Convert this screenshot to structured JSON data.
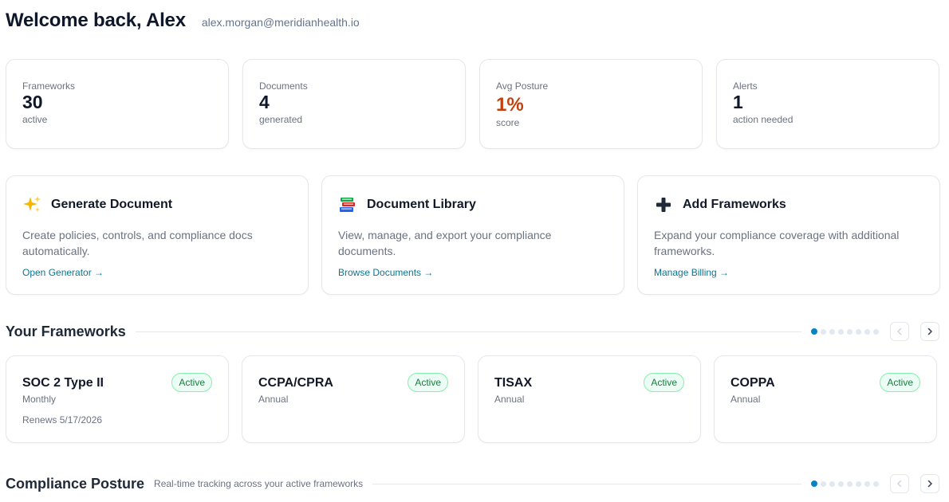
{
  "header": {
    "welcome": "Welcome back, Alex",
    "email": "alex.morgan@meridianhealth.io"
  },
  "stats": [
    {
      "label": "Frameworks",
      "value": "30",
      "sub": "active"
    },
    {
      "label": "Documents",
      "value": "4",
      "sub": "generated"
    },
    {
      "label": "Avg Posture",
      "value": "1%",
      "sub": "score",
      "value_color": "#c2410c"
    },
    {
      "label": "Alerts",
      "value": "1",
      "sub": "action needed"
    }
  ],
  "actions": [
    {
      "icon": "sparkles-icon",
      "title": "Generate Document",
      "desc": "Create policies, controls, and compliance docs automatically.",
      "link": "Open Generator →"
    },
    {
      "icon": "books-icon",
      "title": "Document Library",
      "desc": "View, manage, and export your compliance documents.",
      "link": "Browse Documents →"
    },
    {
      "icon": "plus-icon",
      "title": "Add Frameworks",
      "desc": "Expand your compliance coverage with additional frameworks.",
      "link": "Manage Billing →"
    }
  ],
  "frameworks_section": {
    "title": "Your Frameworks",
    "page_count": 8,
    "active_page": 1
  },
  "frameworks": [
    {
      "name": "SOC 2 Type II",
      "frequency": "Monthly",
      "renews": "Renews 5/17/2026",
      "status": "Active"
    },
    {
      "name": "CCPA/CPRA",
      "frequency": "Annual",
      "renews": "",
      "status": "Active"
    },
    {
      "name": "TISAX",
      "frequency": "Annual",
      "renews": "",
      "status": "Active"
    },
    {
      "name": "COPPA",
      "frequency": "Annual",
      "renews": "",
      "status": "Active"
    }
  ],
  "posture_section": {
    "title": "Compliance Posture",
    "subtitle": "Real-time tracking across your active frameworks",
    "page_count": 8,
    "active_page": 1
  },
  "colors": {
    "accent": "#0284c7",
    "link": "#0e7490",
    "badge_bg": "#ecfdf5",
    "badge_text": "#15803d",
    "warn": "#c2410c"
  }
}
